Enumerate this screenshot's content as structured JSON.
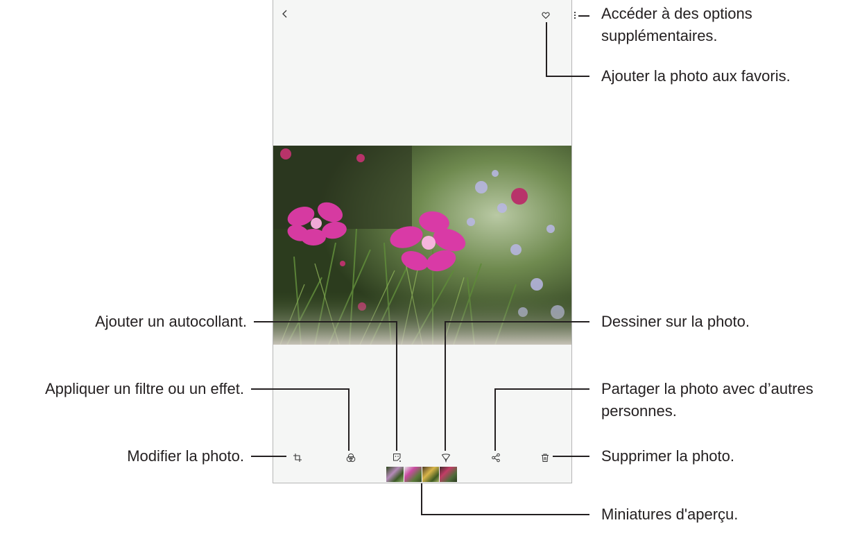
{
  "colors": {
    "accent": "#231f20",
    "frame": "#b5b5b5",
    "screen": "#f5f6f5"
  },
  "toolbar_top": {
    "back_icon": "chevron-left-icon",
    "favorite_icon": "heart-outline-icon",
    "more_icon": "vertical-dots-icon"
  },
  "toolbar_bottom": {
    "icons": [
      "crop-rotate-icon",
      "filter-circles-icon",
      "sticker-icon",
      "brush-icon",
      "share-icon",
      "trash-icon"
    ]
  },
  "thumbnails": {
    "count": 4
  },
  "callouts": {
    "more_options": [
      "Accéder à des options",
      "supplémentaires."
    ],
    "favorite": "Ajouter la photo aux favoris.",
    "sticker": "Ajouter un autocollant.",
    "draw": "Dessiner sur la photo.",
    "filter": "Appliquer un filtre ou un effet.",
    "share": [
      "Partager la photo avec d’autres",
      "personnes."
    ],
    "edit": "Modifier la photo.",
    "delete": "Supprimer la photo.",
    "thumbnails": "Miniatures d'aperçu."
  }
}
